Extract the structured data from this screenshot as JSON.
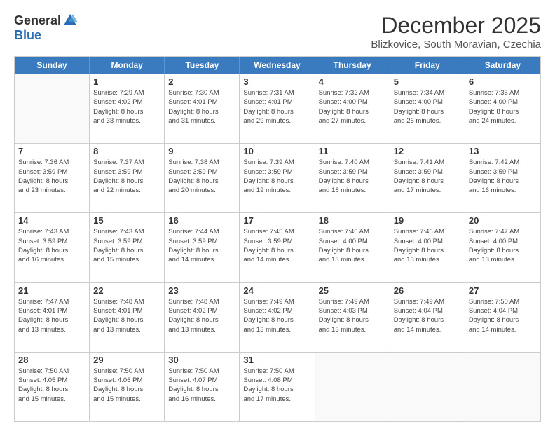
{
  "header": {
    "logo_general": "General",
    "logo_blue": "Blue",
    "month_title": "December 2025",
    "location": "Blizkovice, South Moravian, Czechia"
  },
  "days": [
    "Sunday",
    "Monday",
    "Tuesday",
    "Wednesday",
    "Thursday",
    "Friday",
    "Saturday"
  ],
  "weeks": [
    [
      {
        "date": "",
        "info": ""
      },
      {
        "date": "1",
        "info": "Sunrise: 7:29 AM\nSunset: 4:02 PM\nDaylight: 8 hours\nand 33 minutes."
      },
      {
        "date": "2",
        "info": "Sunrise: 7:30 AM\nSunset: 4:01 PM\nDaylight: 8 hours\nand 31 minutes."
      },
      {
        "date": "3",
        "info": "Sunrise: 7:31 AM\nSunset: 4:01 PM\nDaylight: 8 hours\nand 29 minutes."
      },
      {
        "date": "4",
        "info": "Sunrise: 7:32 AM\nSunset: 4:00 PM\nDaylight: 8 hours\nand 27 minutes."
      },
      {
        "date": "5",
        "info": "Sunrise: 7:34 AM\nSunset: 4:00 PM\nDaylight: 8 hours\nand 26 minutes."
      },
      {
        "date": "6",
        "info": "Sunrise: 7:35 AM\nSunset: 4:00 PM\nDaylight: 8 hours\nand 24 minutes."
      }
    ],
    [
      {
        "date": "7",
        "info": "Sunrise: 7:36 AM\nSunset: 3:59 PM\nDaylight: 8 hours\nand 23 minutes."
      },
      {
        "date": "8",
        "info": "Sunrise: 7:37 AM\nSunset: 3:59 PM\nDaylight: 8 hours\nand 22 minutes."
      },
      {
        "date": "9",
        "info": "Sunrise: 7:38 AM\nSunset: 3:59 PM\nDaylight: 8 hours\nand 20 minutes."
      },
      {
        "date": "10",
        "info": "Sunrise: 7:39 AM\nSunset: 3:59 PM\nDaylight: 8 hours\nand 19 minutes."
      },
      {
        "date": "11",
        "info": "Sunrise: 7:40 AM\nSunset: 3:59 PM\nDaylight: 8 hours\nand 18 minutes."
      },
      {
        "date": "12",
        "info": "Sunrise: 7:41 AM\nSunset: 3:59 PM\nDaylight: 8 hours\nand 17 minutes."
      },
      {
        "date": "13",
        "info": "Sunrise: 7:42 AM\nSunset: 3:59 PM\nDaylight: 8 hours\nand 16 minutes."
      }
    ],
    [
      {
        "date": "14",
        "info": "Sunrise: 7:43 AM\nSunset: 3:59 PM\nDaylight: 8 hours\nand 16 minutes."
      },
      {
        "date": "15",
        "info": "Sunrise: 7:43 AM\nSunset: 3:59 PM\nDaylight: 8 hours\nand 15 minutes."
      },
      {
        "date": "16",
        "info": "Sunrise: 7:44 AM\nSunset: 3:59 PM\nDaylight: 8 hours\nand 14 minutes."
      },
      {
        "date": "17",
        "info": "Sunrise: 7:45 AM\nSunset: 3:59 PM\nDaylight: 8 hours\nand 14 minutes."
      },
      {
        "date": "18",
        "info": "Sunrise: 7:46 AM\nSunset: 4:00 PM\nDaylight: 8 hours\nand 13 minutes."
      },
      {
        "date": "19",
        "info": "Sunrise: 7:46 AM\nSunset: 4:00 PM\nDaylight: 8 hours\nand 13 minutes."
      },
      {
        "date": "20",
        "info": "Sunrise: 7:47 AM\nSunset: 4:00 PM\nDaylight: 8 hours\nand 13 minutes."
      }
    ],
    [
      {
        "date": "21",
        "info": "Sunrise: 7:47 AM\nSunset: 4:01 PM\nDaylight: 8 hours\nand 13 minutes."
      },
      {
        "date": "22",
        "info": "Sunrise: 7:48 AM\nSunset: 4:01 PM\nDaylight: 8 hours\nand 13 minutes."
      },
      {
        "date": "23",
        "info": "Sunrise: 7:48 AM\nSunset: 4:02 PM\nDaylight: 8 hours\nand 13 minutes."
      },
      {
        "date": "24",
        "info": "Sunrise: 7:49 AM\nSunset: 4:02 PM\nDaylight: 8 hours\nand 13 minutes."
      },
      {
        "date": "25",
        "info": "Sunrise: 7:49 AM\nSunset: 4:03 PM\nDaylight: 8 hours\nand 13 minutes."
      },
      {
        "date": "26",
        "info": "Sunrise: 7:49 AM\nSunset: 4:04 PM\nDaylight: 8 hours\nand 14 minutes."
      },
      {
        "date": "27",
        "info": "Sunrise: 7:50 AM\nSunset: 4:04 PM\nDaylight: 8 hours\nand 14 minutes."
      }
    ],
    [
      {
        "date": "28",
        "info": "Sunrise: 7:50 AM\nSunset: 4:05 PM\nDaylight: 8 hours\nand 15 minutes."
      },
      {
        "date": "29",
        "info": "Sunrise: 7:50 AM\nSunset: 4:06 PM\nDaylight: 8 hours\nand 15 minutes."
      },
      {
        "date": "30",
        "info": "Sunrise: 7:50 AM\nSunset: 4:07 PM\nDaylight: 8 hours\nand 16 minutes."
      },
      {
        "date": "31",
        "info": "Sunrise: 7:50 AM\nSunset: 4:08 PM\nDaylight: 8 hours\nand 17 minutes."
      },
      {
        "date": "",
        "info": ""
      },
      {
        "date": "",
        "info": ""
      },
      {
        "date": "",
        "info": ""
      }
    ]
  ]
}
